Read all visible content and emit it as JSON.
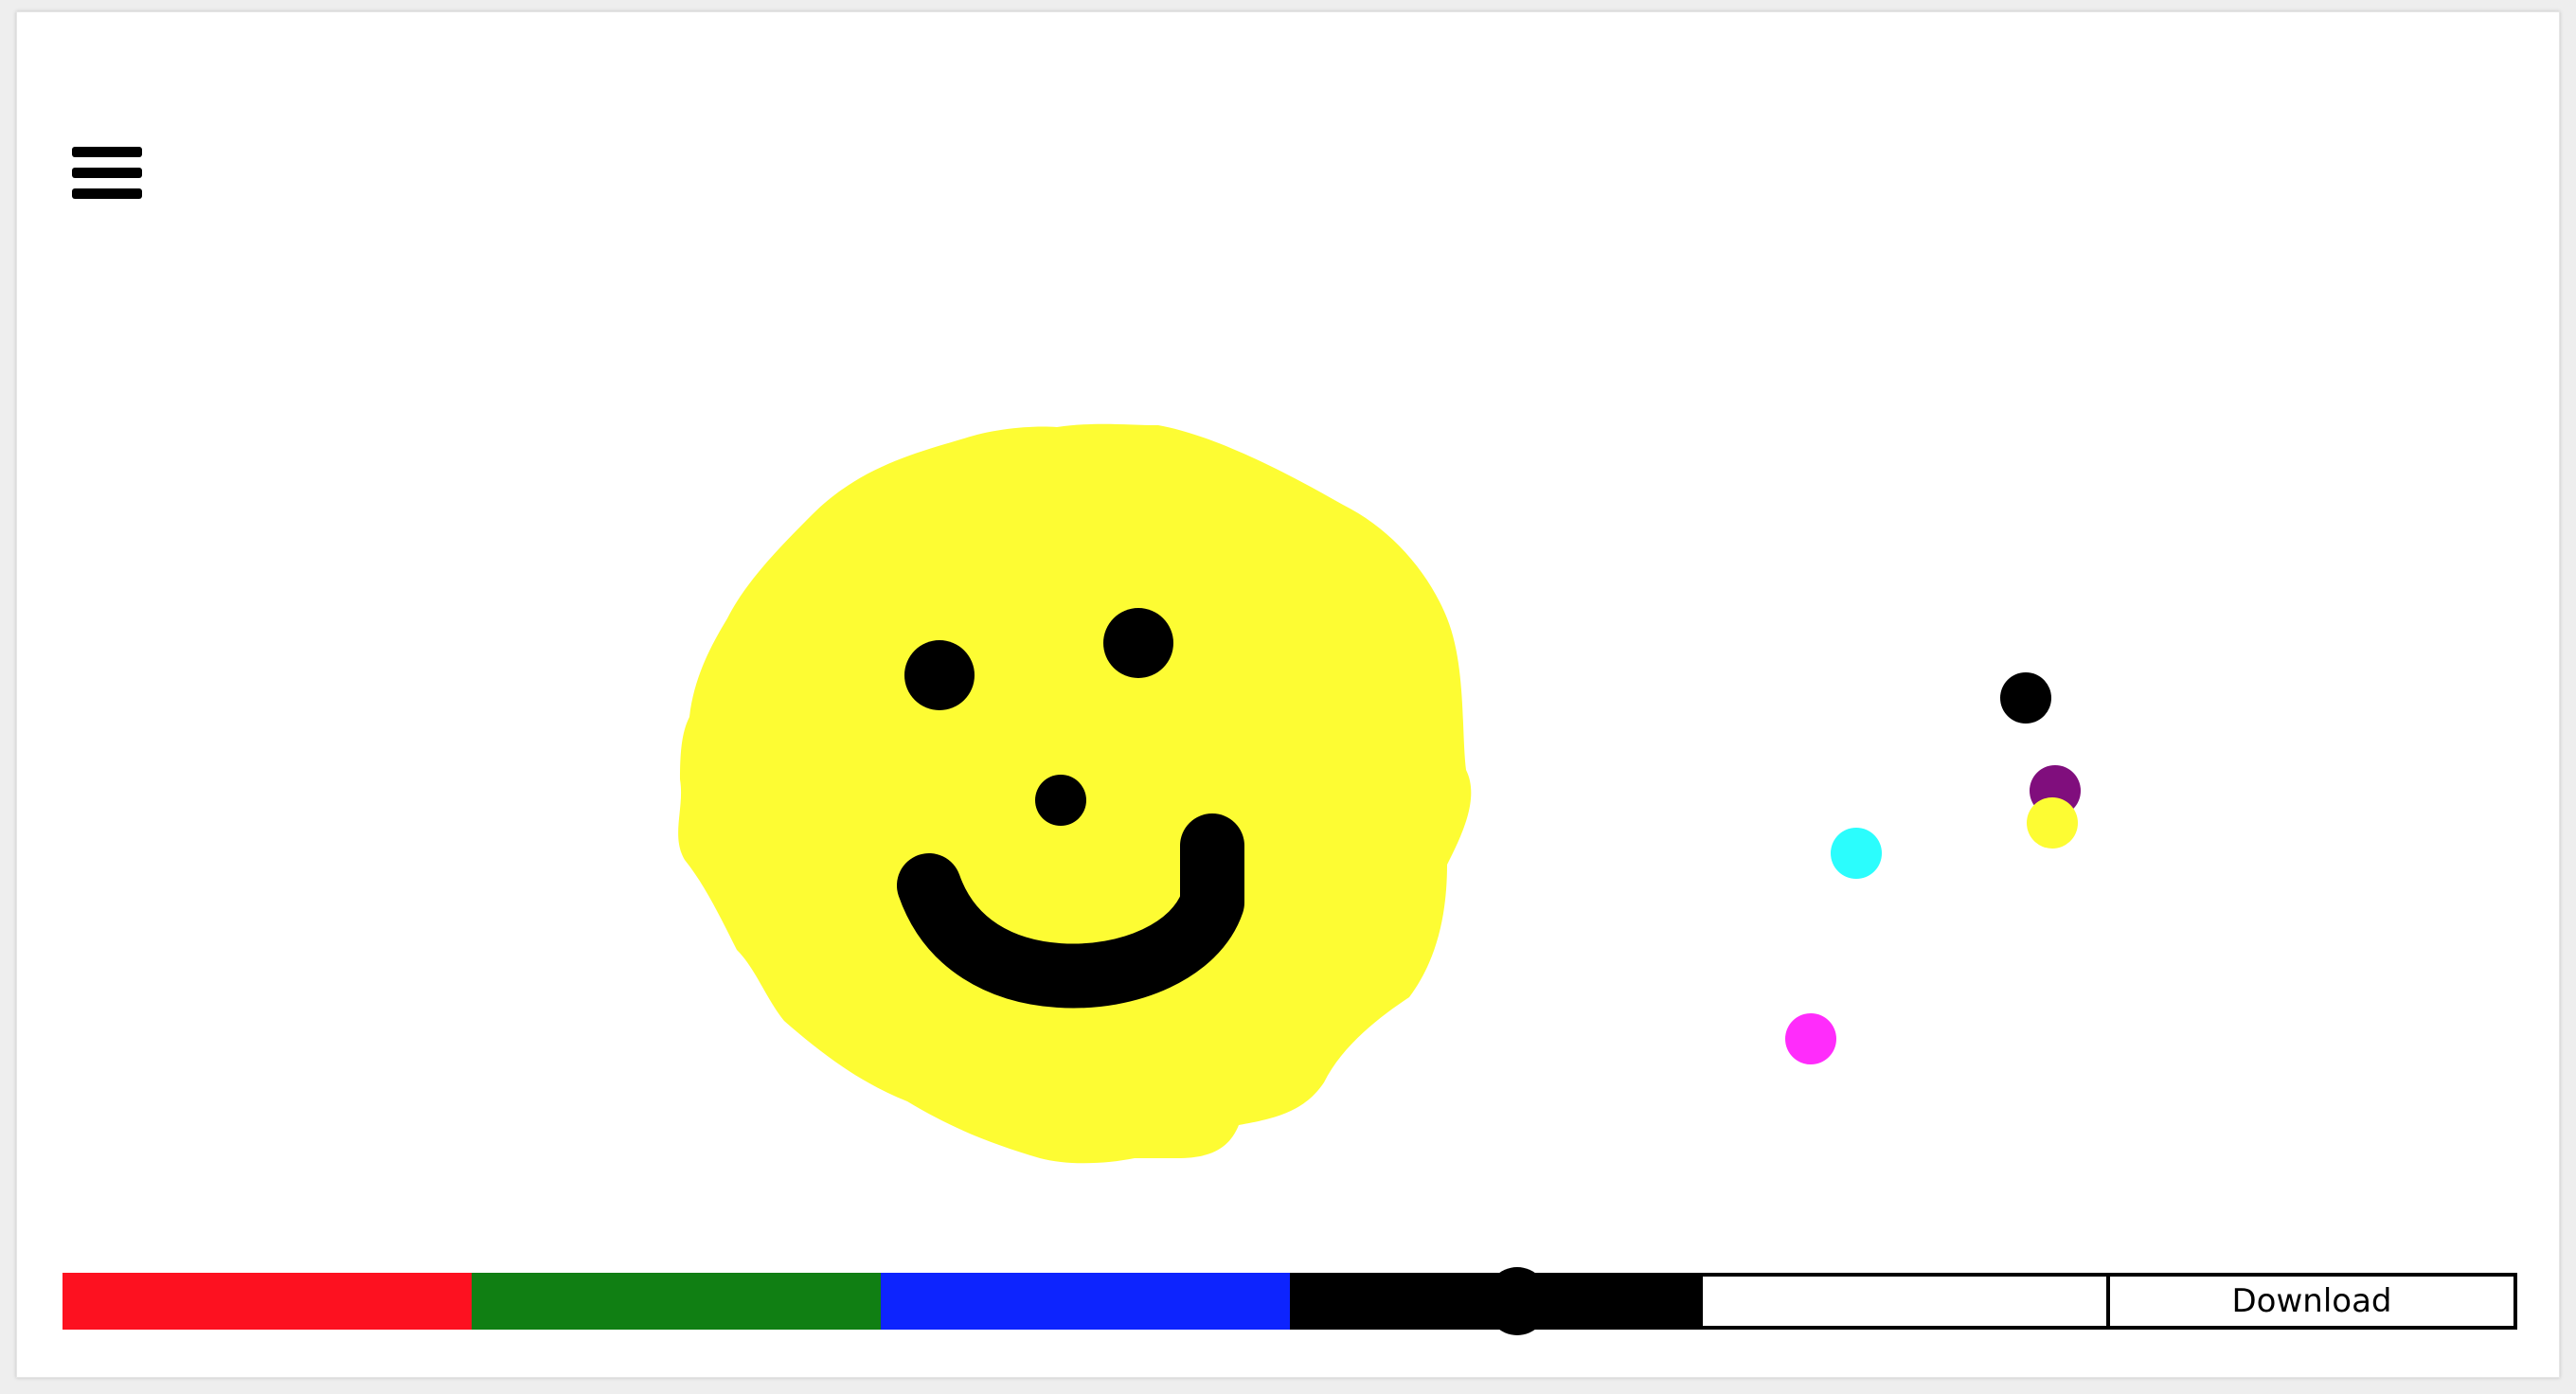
{
  "toolbar": {
    "swatches": [
      {
        "name": "red",
        "color": "#fd1120"
      },
      {
        "name": "green",
        "color": "#107f13"
      },
      {
        "name": "blue",
        "color": "#0d24fe"
      },
      {
        "name": "black",
        "color": "#000000"
      },
      {
        "name": "white",
        "color": "#ffffff"
      }
    ],
    "download_label": "Download",
    "brush_size_slider": {
      "swatch": "black",
      "value_fraction": 0.5
    }
  },
  "menu": {
    "icon": "hamburger-icon"
  },
  "canvas": {
    "background": "#ffffff",
    "dot_colors": [
      "#000000",
      "#800e7d",
      "#fdfc33",
      "#2bfdfd",
      "#ff2cfb"
    ],
    "face_color": "#fdfc33",
    "feature_color": "#000000"
  }
}
